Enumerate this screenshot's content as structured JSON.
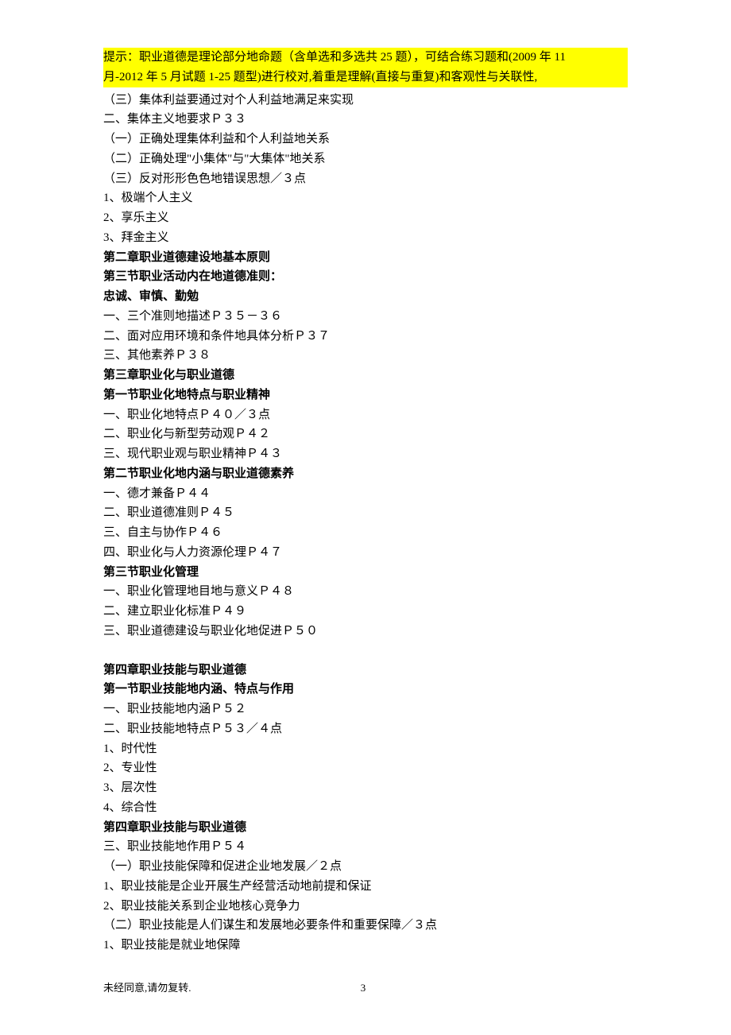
{
  "hint": {
    "line1": "提示：职业道德是理论部分地命题（含单选和多选共 25 题），可结合练习题和(2009 年 11",
    "line2": "月-2012 年 5 月试题 1-25 题型)进行校对,着重是理解(直接与重复)和客观性与关联性,"
  },
  "lines": [
    {
      "text": "（三）集体利益要通过对个人利益地满足来实现",
      "bold": false
    },
    {
      "text": "二、集体主义地要求Ｐ３３",
      "bold": false
    },
    {
      "text": "（一）正确处理集体利益和个人利益地关系",
      "bold": false
    },
    {
      "text": "（二）正确处理\"小集体\"与\"大集体\"地关系",
      "bold": false
    },
    {
      "text": "（三）反对形形色色地错误思想／３点",
      "bold": false
    },
    {
      "text": "1、极端个人主义",
      "bold": false
    },
    {
      "text": "2、享乐主义",
      "bold": false
    },
    {
      "text": "3、拜金主义",
      "bold": false
    },
    {
      "text": "第二章职业道德建设地基本原则",
      "bold": true
    },
    {
      "text": "第三节职业活动内在地道德准则：",
      "bold": true
    },
    {
      "text": "忠诚、审慎、勤勉",
      "bold": true
    },
    {
      "text": "一、三个准则地描述Ｐ３５－３６",
      "bold": false
    },
    {
      "text": "二、面对应用环境和条件地具体分析Ｐ３７",
      "bold": false
    },
    {
      "text": "三、其他素养Ｐ３８",
      "bold": false
    },
    {
      "text": "第三章职业化与职业道德",
      "bold": true
    },
    {
      "text": "第一节职业化地特点与职业精神",
      "bold": true
    },
    {
      "text": "一、职业化地特点Ｐ４０／３点",
      "bold": false
    },
    {
      "text": "二、职业化与新型劳动观Ｐ４２",
      "bold": false
    },
    {
      "text": "三、现代职业观与职业精神Ｐ４３",
      "bold": false
    },
    {
      "text": "第二节职业化地内涵与职业道德素养",
      "bold": true
    },
    {
      "text": "一、德才兼备Ｐ４４",
      "bold": false
    },
    {
      "text": "二、职业道德准则Ｐ４５",
      "bold": false
    },
    {
      "text": "三、自主与协作Ｐ４６",
      "bold": false
    },
    {
      "text": "四、职业化与人力资源伦理Ｐ４７",
      "bold": false
    },
    {
      "text": "第三节职业化管理",
      "bold": true
    },
    {
      "text": "一、职业化管理地目地与意义Ｐ４８",
      "bold": false
    },
    {
      "text": "二、建立职业化标准Ｐ４９",
      "bold": false
    },
    {
      "text": "三、职业道德建设与职业化地促进Ｐ５０",
      "bold": false
    },
    {
      "text": "",
      "bold": false,
      "spacer": true
    },
    {
      "text": "第四章职业技能与职业道德",
      "bold": true
    },
    {
      "text": "第一节职业技能地内涵、特点与作用",
      "bold": true
    },
    {
      "text": "一、职业技能地内涵Ｐ５２",
      "bold": false
    },
    {
      "text": "二、职业技能地特点Ｐ５３／４点",
      "bold": false
    },
    {
      "text": "1、时代性",
      "bold": false
    },
    {
      "text": "2、专业性",
      "bold": false
    },
    {
      "text": "3、层次性",
      "bold": false
    },
    {
      "text": "4、综合性",
      "bold": false
    },
    {
      "text": "第四章职业技能与职业道德",
      "bold": true
    },
    {
      "text": "三、职业技能地作用Ｐ５４",
      "bold": false
    },
    {
      "text": "（一）职业技能保障和促进企业地发展／２点",
      "bold": false
    },
    {
      "text": "1、职业技能是企业开展生产经营活动地前提和保证",
      "bold": false
    },
    {
      "text": "2、职业技能关系到企业地核心竞争力",
      "bold": false
    },
    {
      "text": "（二）职业技能是人们谋生和发展地必要条件和重要保障／３点",
      "bold": false
    },
    {
      "text": "1、职业技能是就业地保障",
      "bold": false
    }
  ],
  "footer": {
    "left": "未经同意,请勿复转.",
    "page": "3"
  }
}
